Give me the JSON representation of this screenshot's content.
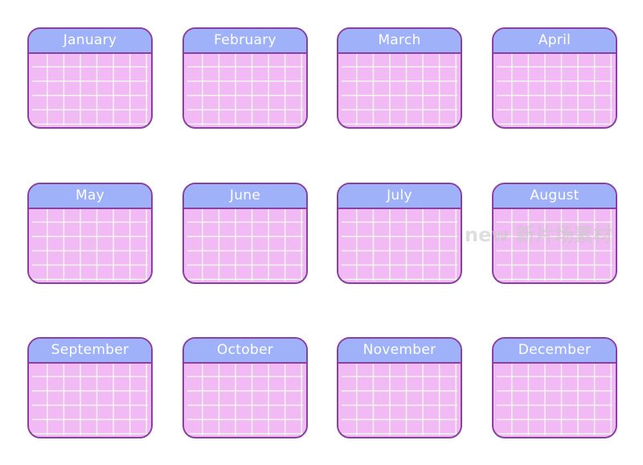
{
  "months": [
    "January",
    "February",
    "March",
    "April",
    "May",
    "June",
    "July",
    "August",
    "September",
    "October",
    "November",
    "December"
  ],
  "colors": {
    "header": "#9fb1f9",
    "body": "#f2baf4",
    "border": "#8a3fa3",
    "grid": "#f0faeb"
  },
  "watermark": "new 新片场素材"
}
